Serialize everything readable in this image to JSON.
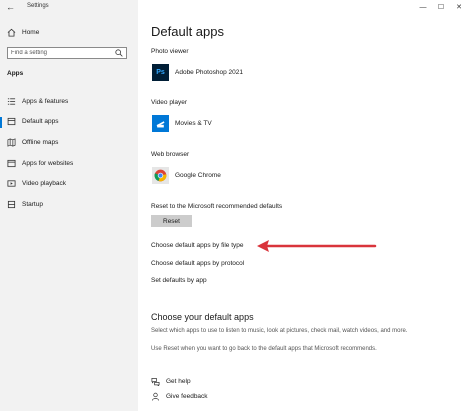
{
  "window": {
    "title": "Settings",
    "back_icon": "back-arrow-icon",
    "controls": [
      "minimize-icon",
      "maximize-icon",
      "close-icon"
    ]
  },
  "sidebar": {
    "home_label": "Home",
    "search_placeholder": "Find a setting",
    "section_label": "Apps",
    "items": [
      {
        "label": "Apps & features",
        "icon": "apps-features-icon",
        "active": false
      },
      {
        "label": "Default apps",
        "icon": "default-apps-icon",
        "active": true
      },
      {
        "label": "Offline maps",
        "icon": "map-icon",
        "active": false
      },
      {
        "label": "Apps for websites",
        "icon": "web-apps-icon",
        "active": false
      },
      {
        "label": "Video playback",
        "icon": "video-icon",
        "active": false
      },
      {
        "label": "Startup",
        "icon": "startup-icon",
        "active": false
      }
    ]
  },
  "main": {
    "title": "Default apps",
    "photo_viewer": {
      "label": "Photo viewer",
      "app": "Adobe Photoshop 2021"
    },
    "video_player": {
      "label": "Video player",
      "app": "Movies & TV"
    },
    "web_browser": {
      "label": "Web browser",
      "app": "Google Chrome"
    },
    "reset_label": "Reset to the Microsoft recommended defaults",
    "reset_button": "Reset",
    "links": [
      "Choose default apps by file type",
      "Choose default apps by protocol",
      "Set defaults by app"
    ],
    "choose_title": "Choose your default apps",
    "choose_text_1": "Select which apps to use to listen to music, look at pictures, check mail, watch videos, and more.",
    "choose_text_2": "Use Reset when you want to go back to the default apps that Microsoft recommends.",
    "help": {
      "get_help": "Get help",
      "give_feedback": "Give feedback"
    }
  },
  "colors": {
    "accent": "#0078d7",
    "arrow": "#d9343b",
    "sidebar_bg": "#f2f2f2"
  }
}
